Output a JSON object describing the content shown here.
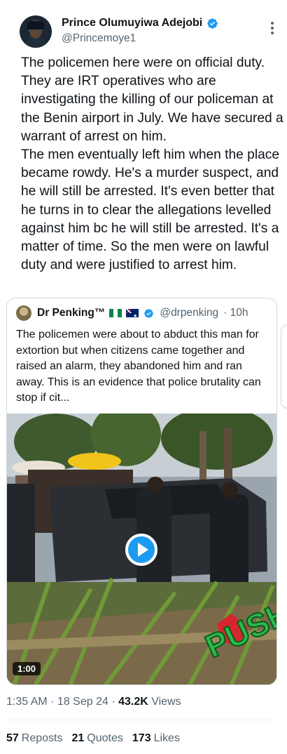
{
  "author": {
    "display_name": "Prince Olumuyiwa Adejobi",
    "handle": "@Princemoye1",
    "verified": true
  },
  "tweet": {
    "text": "The policemen here were on official duty. They are IRT operatives who are investigating the killing of our policeman at the Benin airport in July. We have secured a warrant of arrest on him.\nThe men eventually left him when the place became rowdy. He's a murder suspect, and he will still be arrested. It's even better that he turns in to clear the allegations levelled against him bc he will still be arrested. It's a matter of time. So the men were on lawful duty and were justified to arrest him."
  },
  "quoted": {
    "display_name": "Dr Penking™",
    "handle": "@drpenking",
    "time": "· 10h",
    "text": "The policemen were about to abduct this man for extortion but when citizens came together and raised an alarm, they abandoned him and ran away. This is an evidence that police brutality can stop if cit...",
    "video": {
      "duration": "1:00",
      "watermark": "PUSH EM"
    }
  },
  "meta": {
    "time": "1:35 AM · 18 Sep 24 · ",
    "views_count": "43.2K",
    "views_label": " Views"
  },
  "stats": [
    {
      "count": "57",
      "label": "Reposts"
    },
    {
      "count": "21",
      "label": "Quotes"
    },
    {
      "count": "173",
      "label": "Likes"
    }
  ],
  "colors": {
    "accent": "#1d9bf0",
    "text_primary": "#0f1419",
    "text_secondary": "#536471",
    "border": "#cfd9de"
  }
}
